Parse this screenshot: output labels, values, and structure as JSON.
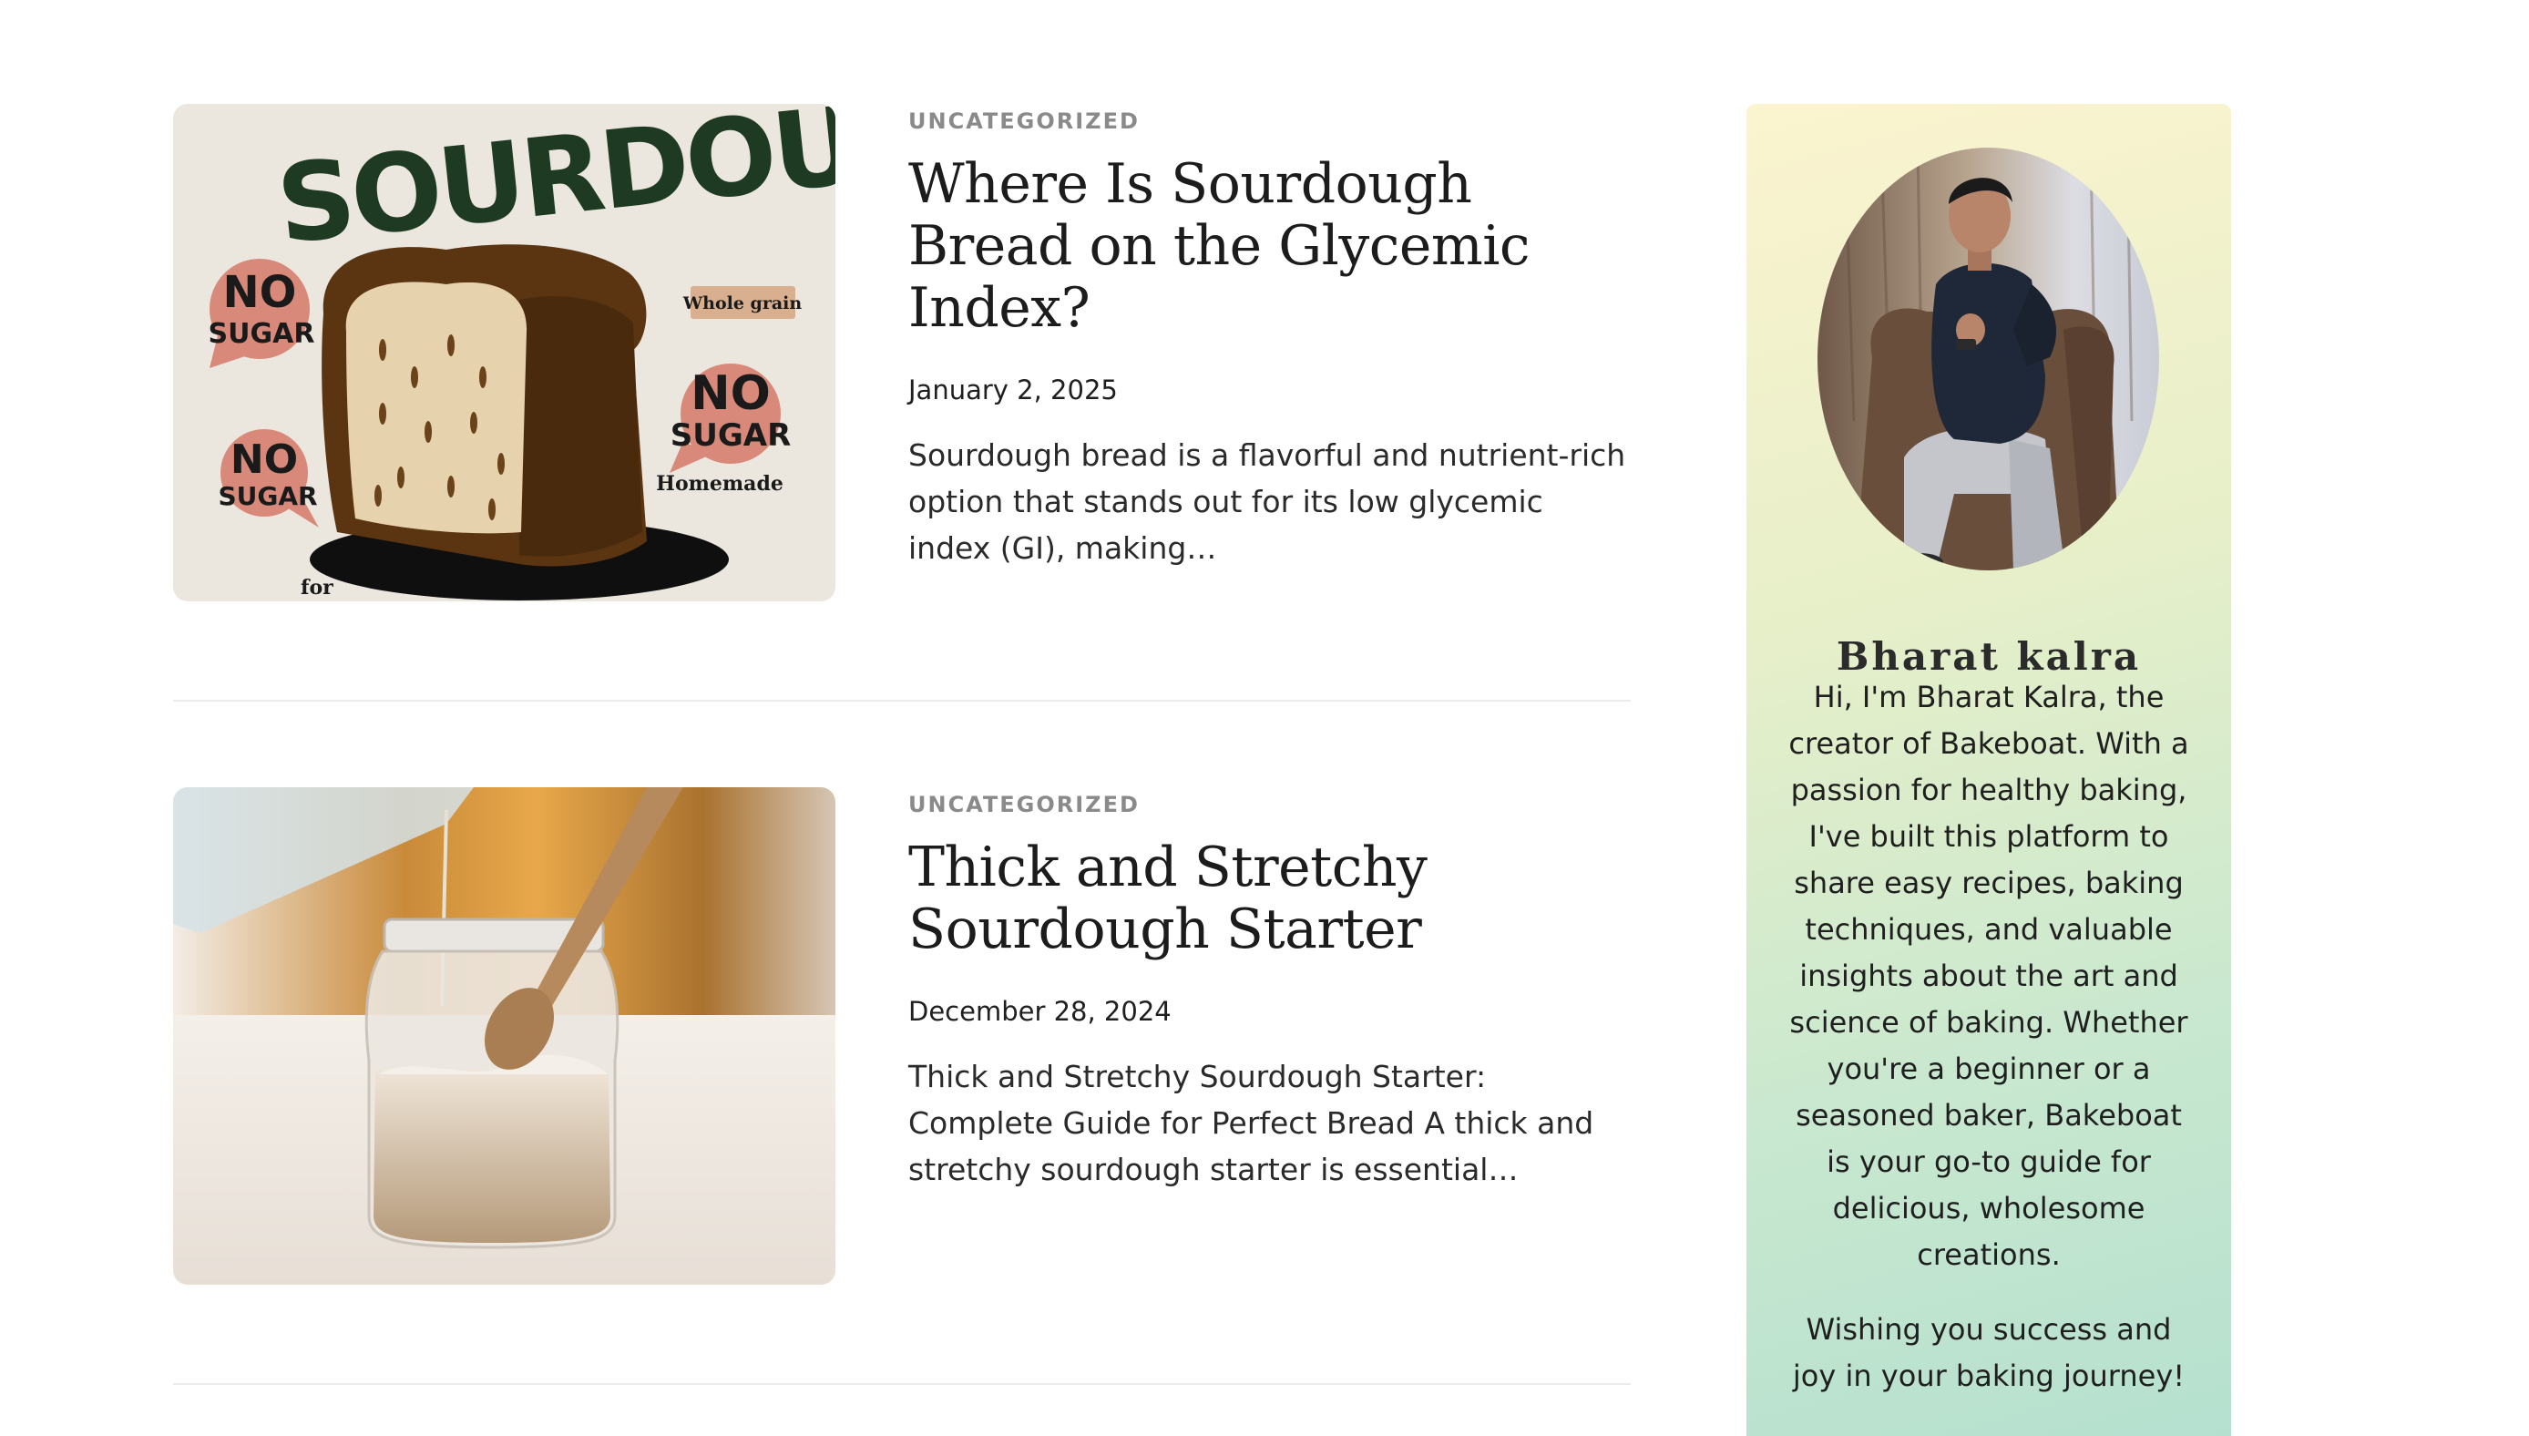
{
  "posts": [
    {
      "category": "UNCATEGORIZED",
      "title": "Where Is Sourdough Bread on the Glycemic Index?",
      "date": "January 2, 2025",
      "excerpt": "Sourdough bread is a flavorful and nutrient-rich option that stands out for its low glycemic index (GI), making…",
      "image": {
        "headline": "SOURDOUGH",
        "badges": [
          "NO",
          "SUGAR"
        ],
        "tags": [
          "Whole grain",
          "Homemade"
        ],
        "footer": "for"
      }
    },
    {
      "category": "UNCATEGORIZED",
      "title": "Thick and Stretchy Sourdough Starter",
      "date": "December 28, 2024",
      "excerpt": "Thick and Stretchy Sourdough Starter: Complete Guide for Perfect Bread A thick and stretchy sourdough starter is essential…"
    }
  ],
  "author": {
    "name": "Bharat kalra",
    "bio": "Hi, I'm Bharat Kalra, the creator of Bakeboat. With a passion for healthy baking, I've built this platform to share easy recipes, baking techniques, and valuable insights about the art and science of baking. Whether you're a beginner or a seasoned baker, Bakeboat is your go-to guide for delicious, wholesome creations.",
    "closing": "Wishing you success and joy in your baking journey!"
  },
  "colors": {
    "category": "#8a8a8a",
    "title": "#1c1c1c",
    "card_gradient_top": "#fbf4cf",
    "card_gradient_bottom": "#b5e0cf"
  }
}
